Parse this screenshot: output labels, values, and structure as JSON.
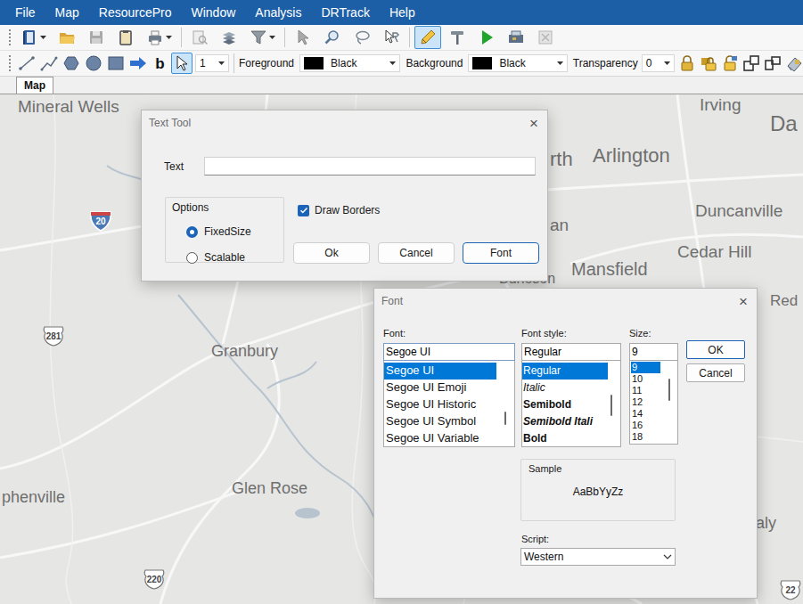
{
  "menu": [
    "File",
    "Map",
    "ResourcePro",
    "Window",
    "Analysis",
    "DRTrack",
    "Help"
  ],
  "toolbar_main": [
    [
      {
        "icon": "book",
        "dropdown": true,
        "disabled": false,
        "selected": false
      },
      {
        "icon": "folder",
        "dropdown": false,
        "disabled": false,
        "selected": false
      },
      {
        "icon": "save",
        "dropdown": false,
        "disabled": true,
        "selected": false
      },
      {
        "icon": "clipboard",
        "dropdown": false,
        "disabled": false,
        "selected": false
      },
      {
        "icon": "printer",
        "dropdown": true,
        "disabled": false,
        "selected": false
      }
    ],
    [
      {
        "icon": "preview",
        "dropdown": false,
        "disabled": true,
        "selected": false
      },
      {
        "icon": "layers",
        "dropdown": false,
        "disabled": false,
        "selected": false
      },
      {
        "icon": "filter",
        "dropdown": true,
        "disabled": false,
        "selected": false
      }
    ],
    [
      {
        "icon": "pointer",
        "dropdown": false,
        "disabled": true,
        "selected": false
      },
      {
        "icon": "zoom",
        "dropdown": false,
        "disabled": false,
        "selected": false
      },
      {
        "icon": "lasso",
        "dropdown": false,
        "disabled": false,
        "selected": false
      },
      {
        "icon": "pointer-r",
        "dropdown": false,
        "disabled": false,
        "selected": false
      }
    ],
    [
      {
        "icon": "pencil",
        "dropdown": false,
        "disabled": false,
        "selected": true
      },
      {
        "icon": "pin",
        "dropdown": false,
        "disabled": false,
        "selected": false
      },
      {
        "icon": "play",
        "dropdown": false,
        "disabled": false,
        "selected": false
      },
      {
        "icon": "gadget",
        "dropdown": false,
        "disabled": false,
        "selected": false
      },
      {
        "icon": "close-box",
        "dropdown": false,
        "disabled": true,
        "selected": false
      }
    ]
  ],
  "toolbar_draw": {
    "shapes": [
      {
        "kind": "icon",
        "icon": "line",
        "label": "",
        "selected": false
      },
      {
        "kind": "icon",
        "icon": "polyline",
        "label": "",
        "selected": false
      },
      {
        "kind": "icon",
        "icon": "hexagon",
        "label": "",
        "selected": false
      },
      {
        "kind": "icon",
        "icon": "circle",
        "label": "",
        "selected": false
      },
      {
        "kind": "icon",
        "icon": "square",
        "label": "",
        "selected": false
      },
      {
        "kind": "icon",
        "icon": "arrow",
        "label": "",
        "selected": false
      },
      {
        "kind": "text",
        "icon": "",
        "label": "b",
        "selected": false
      },
      {
        "kind": "icon",
        "icon": "pointer",
        "label": "",
        "selected": true
      }
    ],
    "line_width": "1",
    "foreground": {
      "label": "Foreground",
      "value": "Black",
      "color": "#000000"
    },
    "background": {
      "label": "Background",
      "value": "Black",
      "color": "#000000"
    },
    "transparency": {
      "label": "Transparency",
      "value": "0"
    },
    "layer_tools": [
      "lock",
      "lock-stack",
      "lock-open",
      "shrink",
      "expand",
      "eraser"
    ]
  },
  "tabs": [
    {
      "label": "Map",
      "selected": true
    }
  ],
  "map": {
    "labels": [
      "Mineral Wells",
      "Irving",
      "Da",
      "rth",
      "Arlington",
      "Duncanville",
      "an",
      "Cedar Hill",
      "Red",
      "Mansfield",
      "Burleson",
      "Granbury",
      "Glen Rose",
      "phenville",
      "aly"
    ],
    "shields": [
      {
        "text": "20",
        "kind": "interstate"
      },
      {
        "text": "281",
        "kind": "us"
      },
      {
        "text": "220",
        "kind": "us"
      },
      {
        "text": "22",
        "kind": "us"
      }
    ]
  },
  "text_tool": {
    "title": "Text Tool",
    "close": "×",
    "text_label": "Text",
    "text_value": "",
    "options_title": "Options",
    "options": [
      {
        "label": "FixedSize",
        "selected": true
      },
      {
        "label": "Scalable",
        "selected": false
      }
    ],
    "draw_borders": {
      "label": "Draw Borders",
      "checked": true
    },
    "buttons": [
      {
        "label": "Ok",
        "default": false
      },
      {
        "label": "Cancel",
        "default": false
      },
      {
        "label": "Font",
        "default": true
      }
    ]
  },
  "font_dialog": {
    "title": "Font",
    "close": "×",
    "font": {
      "label": "Font:",
      "value": "Segoe UI",
      "items": [
        {
          "label": "Segoe UI",
          "selected": true
        },
        {
          "label": "Segoe UI Emoji",
          "selected": false
        },
        {
          "label": "Segoe UI Historic",
          "selected": false
        },
        {
          "label": "Segoe UI Symbol",
          "selected": false
        },
        {
          "label": "Segoe UI Variable",
          "selected": false
        }
      ]
    },
    "style": {
      "label": "Font style:",
      "value": "Regular",
      "items": [
        {
          "label": "Regular",
          "kind": "regular",
          "selected": true
        },
        {
          "label": "Italic",
          "kind": "italic",
          "selected": false
        },
        {
          "label": "Semibold",
          "kind": "semibold",
          "selected": false
        },
        {
          "label": "Semibold Itali",
          "kind": "semibold-italic",
          "selected": false
        },
        {
          "label": "Bold",
          "kind": "bold",
          "selected": false
        }
      ]
    },
    "size": {
      "label": "Size:",
      "value": "9",
      "items": [
        {
          "label": "9",
          "selected": true
        },
        {
          "label": "10",
          "selected": false
        },
        {
          "label": "11",
          "selected": false
        },
        {
          "label": "12",
          "selected": false
        },
        {
          "label": "14",
          "selected": false
        },
        {
          "label": "16",
          "selected": false
        },
        {
          "label": "18",
          "selected": false
        }
      ]
    },
    "buttons": [
      {
        "label": "OK",
        "default": true
      },
      {
        "label": "Cancel",
        "default": false
      }
    ],
    "sample": {
      "label": "Sample",
      "text": "AaBbYyZz"
    },
    "script": {
      "label": "Script:",
      "value": "Western"
    }
  }
}
